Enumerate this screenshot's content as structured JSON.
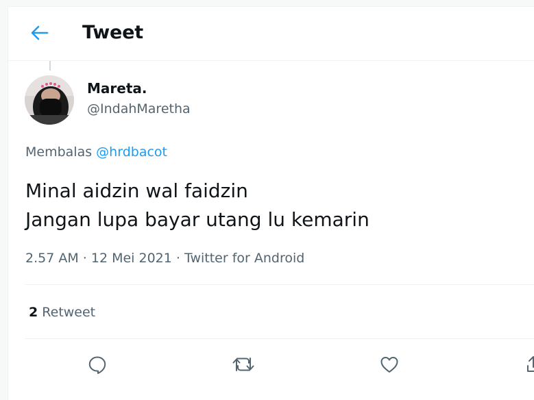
{
  "header": {
    "title": "Tweet",
    "back_icon": "arrow-left-icon"
  },
  "author": {
    "display_name": "Mareta.",
    "handle": "@IndahMaretha",
    "avatar": "avatar-photo"
  },
  "reply": {
    "prefix": "Membalas",
    "mention": "@hrdbacot"
  },
  "tweet": {
    "lines": [
      "Minal aidzin wal faidzin",
      "Jangan lupa bayar utang lu kemarin"
    ]
  },
  "meta": {
    "time": "2.57 AM",
    "separator": " · ",
    "date": "12 Mei 2021",
    "source": "Twitter for Android"
  },
  "stats": {
    "retweet_count": "2",
    "retweet_label": "Retweet"
  },
  "actions": {
    "reply_icon": "reply-icon",
    "retweet_icon": "retweet-icon",
    "like_icon": "heart-icon",
    "share_icon": "share-icon"
  },
  "colors": {
    "accent": "#1d9bf0",
    "text_primary": "#0f1419",
    "text_secondary": "#536471",
    "border": "#eff3f4"
  }
}
